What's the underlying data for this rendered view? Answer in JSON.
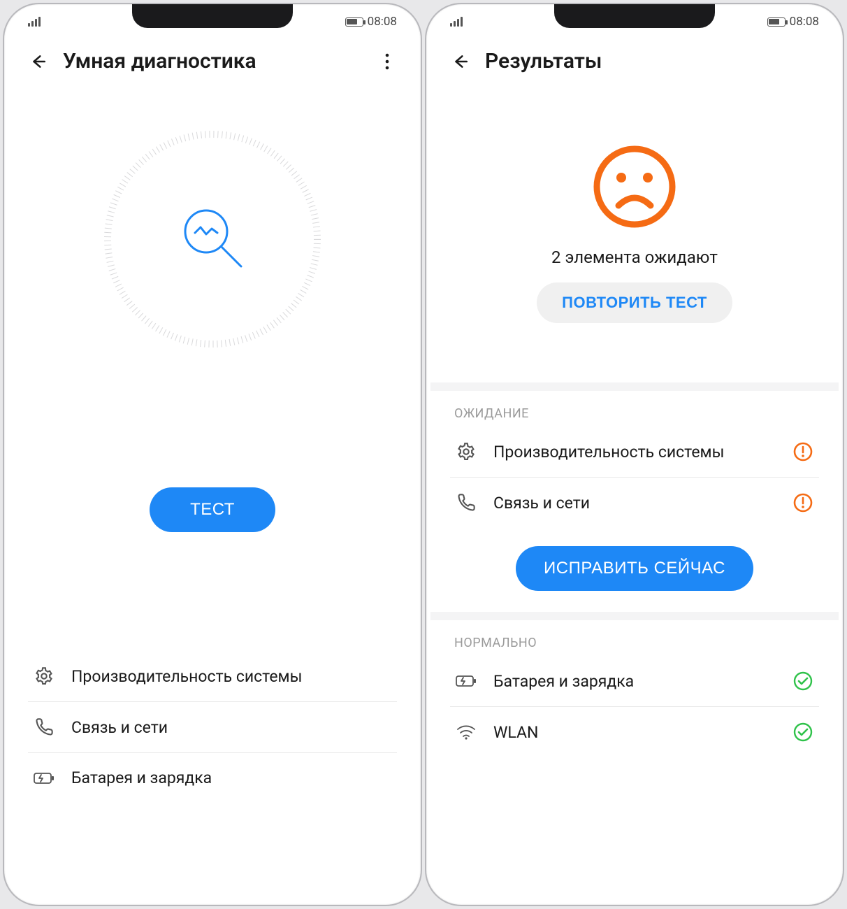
{
  "status": {
    "time": "08:08"
  },
  "left": {
    "title": "Умная диагностика",
    "test_button": "ТЕСТ",
    "items": [
      {
        "label": "Производительность системы"
      },
      {
        "label": "Связь и сети"
      },
      {
        "label": "Батарея и зарядка"
      }
    ]
  },
  "right": {
    "title": "Результаты",
    "pending_text": "2 элемента ожидают",
    "retry_button": "ПОВТОРИТЬ ТЕСТ",
    "section_waiting": "ОЖИДАНИЕ",
    "waiting_items": [
      {
        "label": "Производительность системы"
      },
      {
        "label": "Связь и сети"
      }
    ],
    "fix_button": "ИСПРАВИТЬ СЕЙЧАС",
    "section_normal": "НОРМАЛЬНО",
    "normal_items": [
      {
        "label": "Батарея и зарядка"
      },
      {
        "label": "WLAN"
      }
    ]
  },
  "colors": {
    "primary": "#1e88f6",
    "warning": "#f56b14",
    "success": "#2fc24a"
  }
}
